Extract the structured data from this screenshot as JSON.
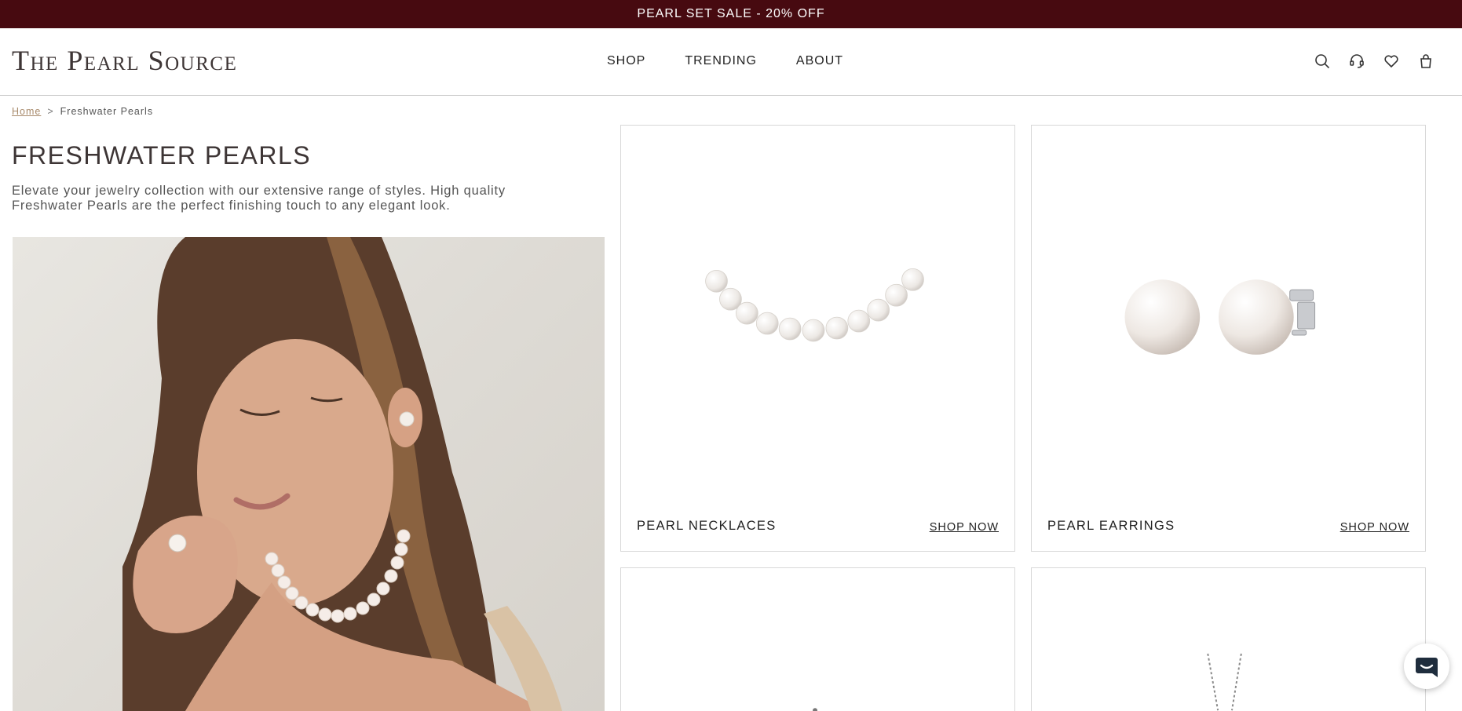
{
  "promo": {
    "text": "PEARL SET SALE - 20% OFF"
  },
  "header": {
    "logo": "The Pearl Source",
    "nav": [
      "SHOP",
      "TRENDING",
      "ABOUT"
    ],
    "icons": [
      "search-icon",
      "support-headset-icon",
      "heart-icon",
      "shopping-bag-icon"
    ]
  },
  "breadcrumb": {
    "home": "Home",
    "separator": ">",
    "current": "Freshwater Pearls"
  },
  "page": {
    "title": "FRESHWATER PEARLS",
    "description": "Elevate your jewelry collection with our extensive range of styles. High quality Freshwater Pearls are the perfect finishing touch to any elegant look."
  },
  "cards": [
    {
      "label": "PEARL NECKLACES",
      "link": "SHOP NOW"
    },
    {
      "label": "PEARL EARRINGS",
      "link": "SHOP NOW"
    }
  ],
  "colors": {
    "promo_bg": "#470a10",
    "breadcrumb_home": "#a88a6b",
    "title": "#3d3535"
  }
}
